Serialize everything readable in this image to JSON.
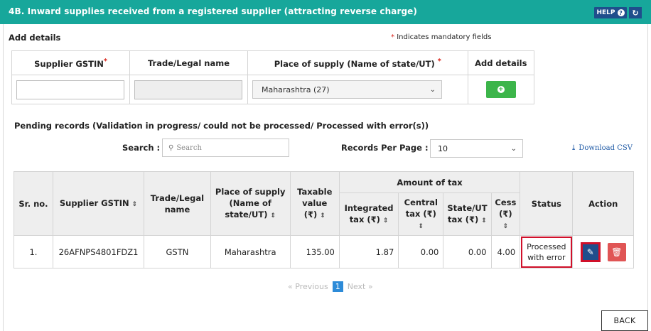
{
  "header": {
    "title": "4B. Inward supplies received from a registered supplier (attracting reverse charge)",
    "help_label": "HELP",
    "help_icon": "?",
    "refresh_icon": "↻"
  },
  "add_section": {
    "title": "Add details",
    "mandatory_star": "*",
    "mandatory_note": "Indicates mandatory fields",
    "columns": {
      "supplier_gstin": "Supplier GSTIN",
      "trade_name": "Trade/Legal name",
      "place_of_supply": "Place of supply (Name of state/UT)",
      "add_details": "Add details"
    },
    "place_of_supply_value": "Maharashtra (27)",
    "add_icon": "+"
  },
  "pending": {
    "title": "Pending records (Validation in progress/ could not be processed/ Processed with error(s))",
    "search_label": "Search :",
    "search_placeholder": "Search",
    "records_per_page_label": "Records Per Page :",
    "records_per_page_value": "10",
    "download_label": "Download CSV"
  },
  "table": {
    "headers": {
      "sr_no": "Sr. no.",
      "supplier_gstin": "Supplier GSTIN",
      "trade_name_1": "Trade/Legal",
      "trade_name_2": "name",
      "pos_1": "Place of supply",
      "pos_2": "(Name of",
      "pos_3": "state/UT)",
      "taxable_1": "Taxable",
      "taxable_2": "value",
      "taxable_3": "(₹)",
      "amount_of_tax": "Amount of tax",
      "integrated_1": "Integrated",
      "integrated_2": "tax (₹)",
      "central_1": "Central",
      "central_2": "tax (₹)",
      "state_1": "State/UT",
      "state_2": "tax (₹)",
      "cess_1": "Cess",
      "cess_2": "(₹)",
      "status": "Status",
      "action": "Action",
      "sort_icon": "⇕"
    },
    "rows": [
      {
        "sr_no": "1.",
        "supplier_gstin": "26AFNPS4801FDZ1",
        "trade_name": "GSTN",
        "place_of_supply": "Maharashtra",
        "taxable_value": "135.00",
        "integrated_tax": "1.87",
        "central_tax": "0.00",
        "state_tax": "0.00",
        "cess": "4.00",
        "status_1": "Processed",
        "status_2": "with error"
      }
    ]
  },
  "pagination": {
    "previous": "« Previous",
    "current": "1",
    "next": "Next »"
  },
  "footer": {
    "back_label": "BACK"
  }
}
